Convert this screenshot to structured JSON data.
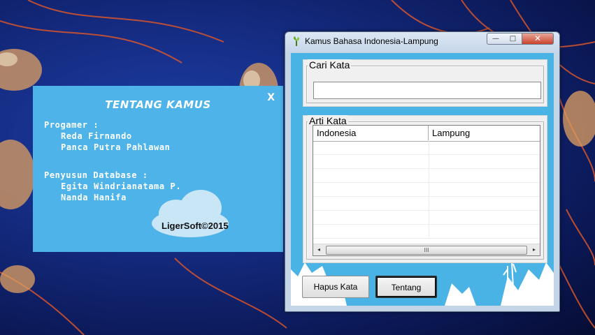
{
  "about": {
    "title": "TENTANG KAMUS",
    "close": "X",
    "programmer_heading": "Progamer :",
    "programmers": [
      "Reda Firnando",
      "Panca Putra Pahlawan"
    ],
    "database_heading": "Penyusun Database :",
    "database_authors": [
      "Egita Windrianatama P.",
      "Nanda Hanifa"
    ],
    "copyright": "LigerSoft©2015"
  },
  "window": {
    "title": "Kamus Bahasa Indonesia-Lampung",
    "min": "—",
    "max": "□",
    "close": "✕"
  },
  "search": {
    "group_label": "Cari Kata",
    "value": ""
  },
  "results": {
    "group_label": "Arti Kata",
    "columns": [
      "Indonesia",
      "Lampung"
    ],
    "scroll_thumb": "III"
  },
  "buttons": {
    "clear": "Hapus Kata",
    "about": "Tentang"
  },
  "colors": {
    "panel_blue": "#4db3e8",
    "desktop_blue": "#13287a"
  }
}
